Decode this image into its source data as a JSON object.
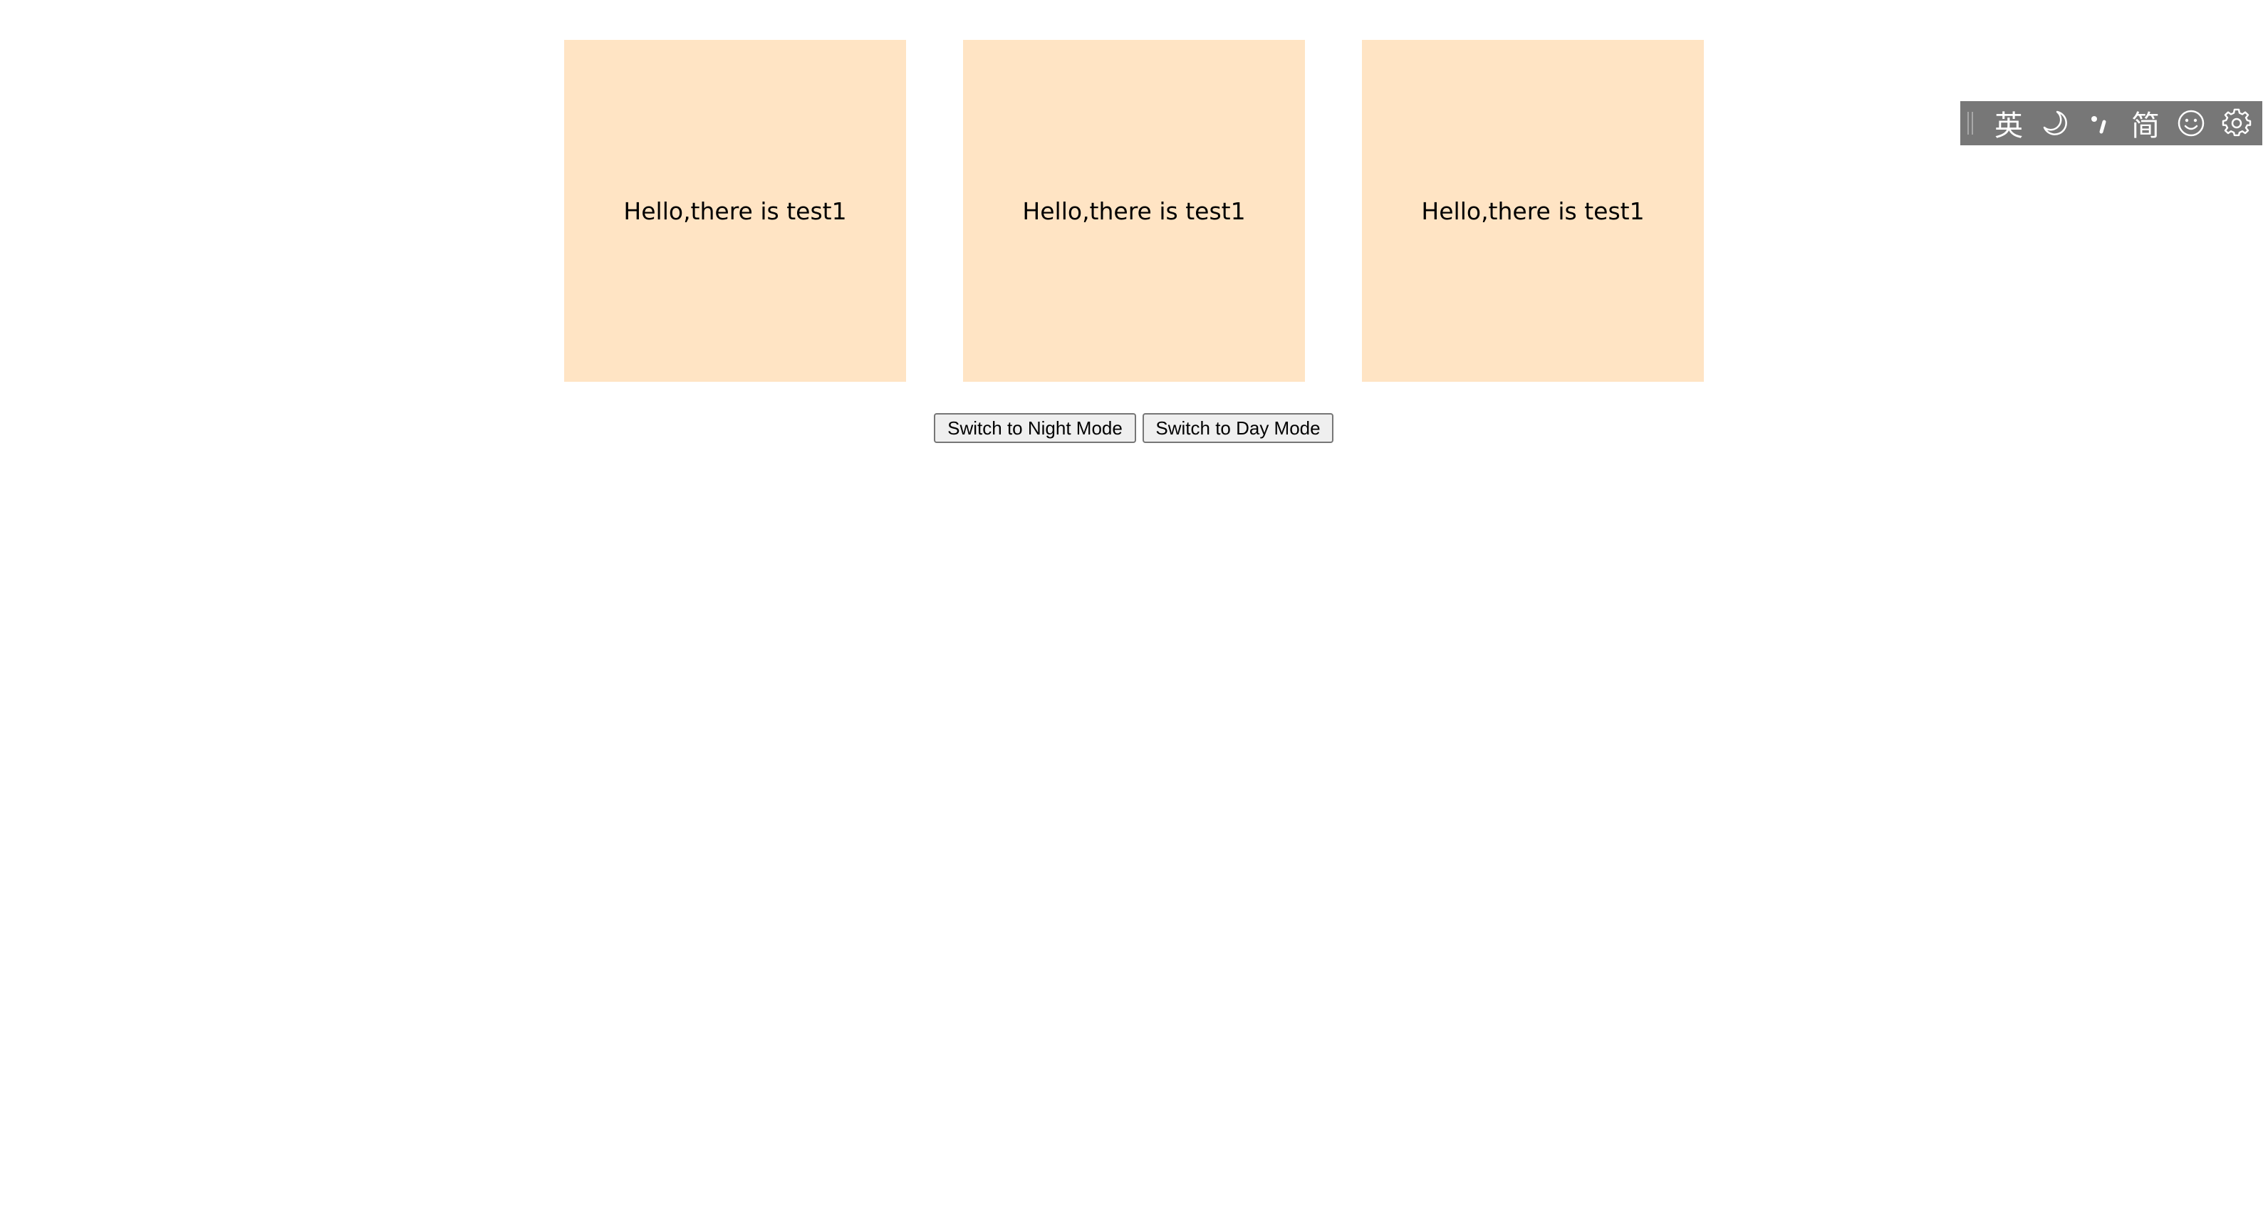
{
  "cards": [
    {
      "text": "Hello,there is test1"
    },
    {
      "text": "Hello,there is test1"
    },
    {
      "text": "Hello,there is test1"
    }
  ],
  "buttons": {
    "night_label": "Switch to Night Mode",
    "day_label": "Switch to Day Mode"
  },
  "ime_toolbar": {
    "language_label": "英",
    "script_label": "简",
    "icons": [
      "drag-handle-icon",
      "moon-icon",
      "punctuation-icon",
      "emoji-icon",
      "gear-icon"
    ]
  },
  "colors": {
    "card_background": "#ffe4c4",
    "toolbar_background": "#777777"
  }
}
